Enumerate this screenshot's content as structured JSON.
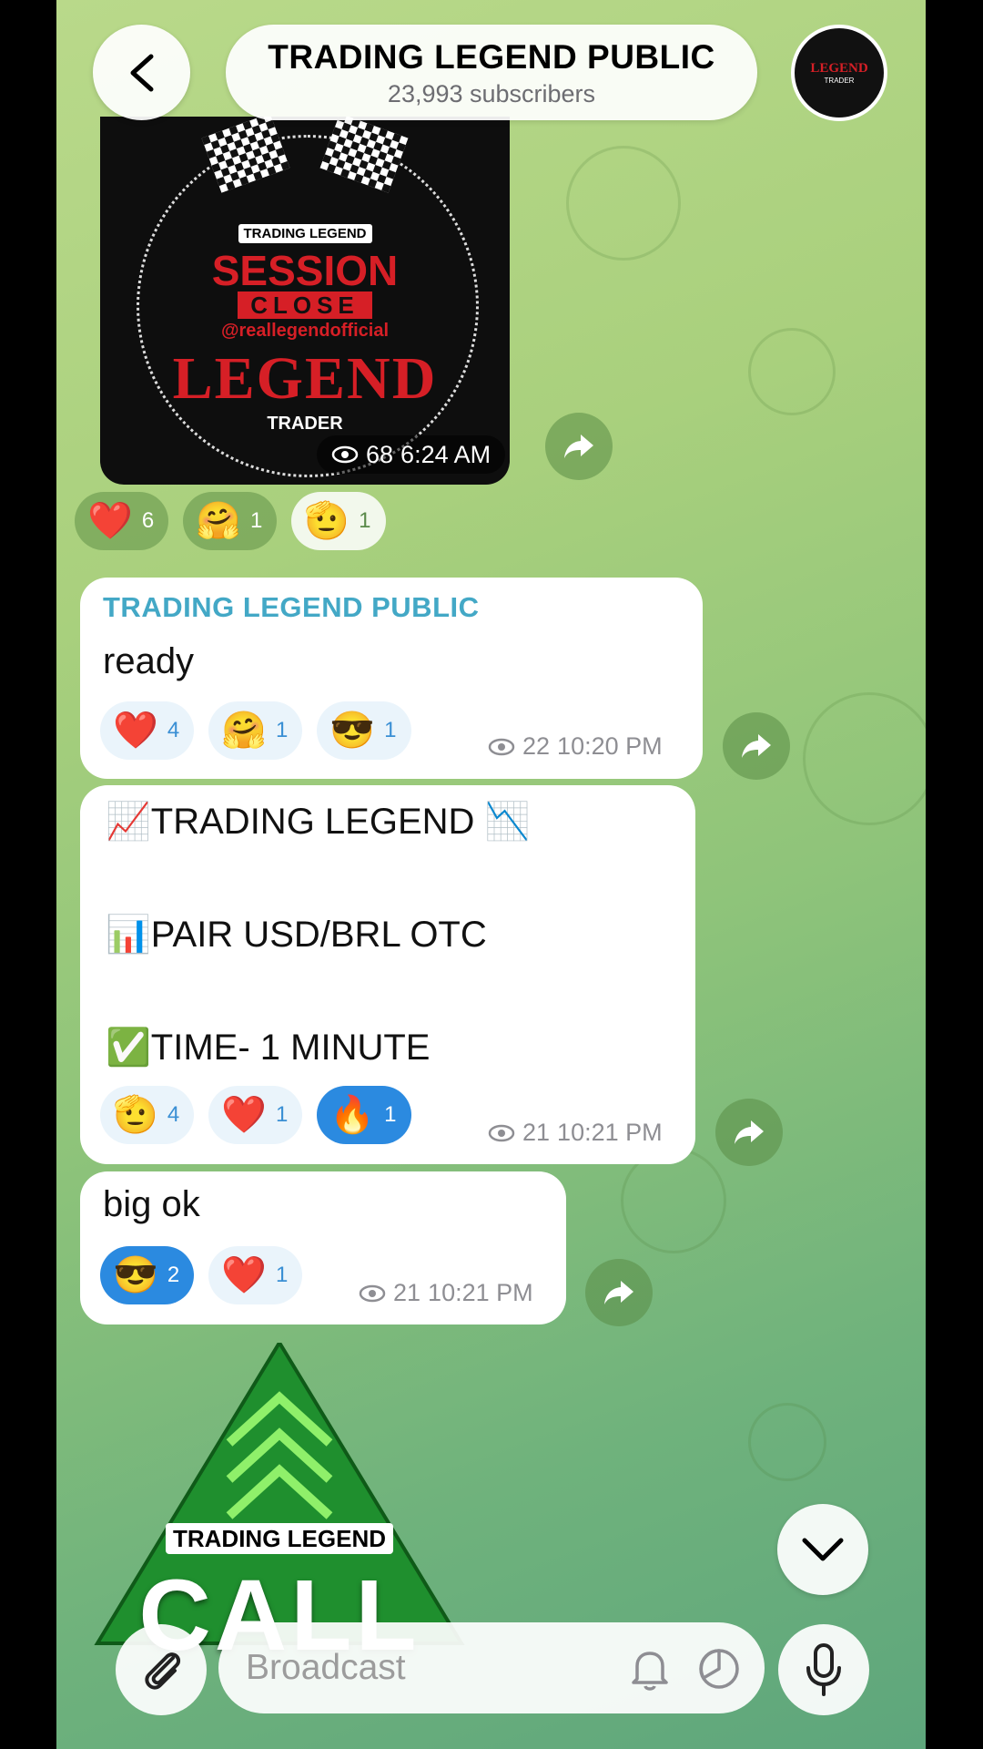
{
  "header": {
    "title": "TRADING LEGEND PUBLIC",
    "subtitle": "23,993 subscribers",
    "avatar_text_main": "LEGEND",
    "avatar_text_sub": "TRADER"
  },
  "messages": [
    {
      "kind": "image",
      "image_text": {
        "top": "TRADING LEGEND",
        "session": "SESSION",
        "close": "CLOSE",
        "handle": "@reallegendofficial",
        "legend": "LEGEND",
        "trader": "TRADER"
      },
      "views": "68",
      "time": "6:24 AM",
      "reactions": [
        {
          "emoji": "❤️",
          "count": "6",
          "selected": false
        },
        {
          "emoji": "🤗",
          "count": "1",
          "selected": false
        },
        {
          "emoji": "🫡",
          "count": "1",
          "selected": true
        }
      ]
    },
    {
      "kind": "text",
      "sender": "TRADING LEGEND PUBLIC",
      "text": "ready",
      "views": "22",
      "time": "10:20 PM",
      "reactions": [
        {
          "emoji": "❤️",
          "count": "4",
          "selected": false
        },
        {
          "emoji": "🤗",
          "count": "1",
          "selected": false
        },
        {
          "emoji": "😎",
          "count": "1",
          "selected": false
        }
      ]
    },
    {
      "kind": "text",
      "lines": [
        "📈TRADING LEGEND 📉",
        "📊PAIR USD/BRL OTC",
        "✅TIME- 1 MINUTE"
      ],
      "views": "21",
      "time": "10:21 PM",
      "reactions": [
        {
          "emoji": "🫡",
          "count": "4",
          "selected": false
        },
        {
          "emoji": "❤️",
          "count": "1",
          "selected": false
        },
        {
          "emoji": "🔥",
          "count": "1",
          "selected": true
        }
      ]
    },
    {
      "kind": "text",
      "text": "big ok",
      "views": "21",
      "time": "10:21 PM",
      "reactions": [
        {
          "emoji": "😎",
          "count": "2",
          "selected": true
        },
        {
          "emoji": "❤️",
          "count": "1",
          "selected": false
        }
      ]
    },
    {
      "kind": "image",
      "image_text": {
        "label": "TRADING LEGEND",
        "word": "CALL"
      }
    }
  ],
  "composer": {
    "placeholder": "Broadcast"
  },
  "icons": {
    "back": "chevron-left-icon",
    "forward": "share-arrow-icon",
    "views": "eye-icon",
    "attach": "paperclip-icon",
    "notify": "bell-icon",
    "timer": "timer-icon",
    "mic": "microphone-icon",
    "jump": "chevron-down-icon"
  },
  "colors": {
    "sender_name": "#43a8c6",
    "reaction_selected": "#2b8ae0",
    "background_top": "#b9d98a",
    "background_bottom": "#5ea67c"
  }
}
